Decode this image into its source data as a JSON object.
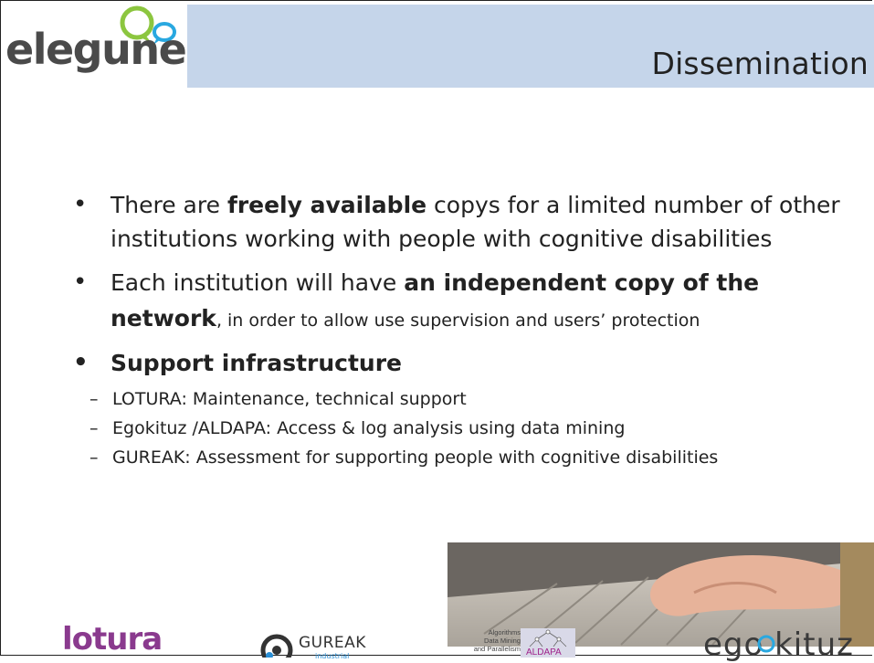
{
  "header": {
    "logo_text": "elegune",
    "title": "Dissemination"
  },
  "bullets": {
    "b1": {
      "pre": "There are ",
      "bold": "freely available",
      "post": " copys for a limited number of other institutions working with people with cognitive disabilities"
    },
    "b2": {
      "pre": "Each institution will have ",
      "bold": "an independent copy of the network",
      "post": ", in order to allow use supervision and users’ protection"
    },
    "b3": {
      "label": "Support infrastructure",
      "items": [
        "LOTURA: Maintenance, technical support",
        "Egokituz /ALDAPA: Access & log analysis using data mining",
        "GUREAK: Assessment for supporting people with cognitive disabilities"
      ]
    }
  },
  "footer": {
    "lotura": "lotura",
    "gureak": "GUREAK",
    "gureak_sub": "industrial",
    "aldapa_lines": [
      "Algorithms",
      "Data Mining",
      "and Parallelism"
    ],
    "aldapa_label": "ALDAPA",
    "egokituz": "ego kituz"
  },
  "colors": {
    "header_band": "#c5d5ea",
    "bubble_green": "#8cc63f",
    "bubble_blue": "#29a8e0",
    "lotura_purple": "#8a3a8e",
    "gureak_blue": "#2a8fd6"
  }
}
